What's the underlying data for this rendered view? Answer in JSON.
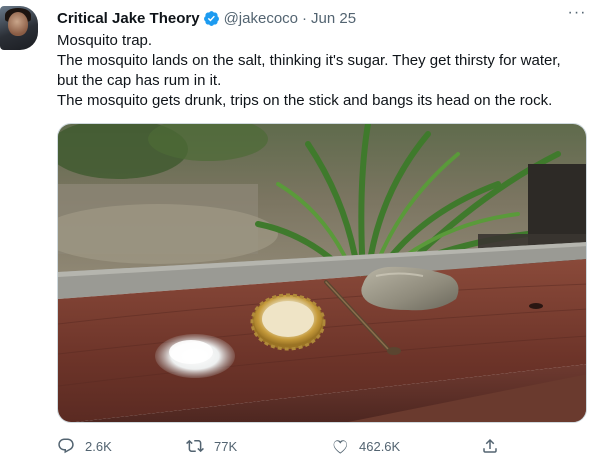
{
  "user": {
    "display_name": "Critical Jake Theory",
    "handle": "@jakecoco",
    "separator": "·",
    "date": "Jun 25"
  },
  "tweet": {
    "lines": [
      "Mosquito trap.",
      "The mosquito lands on the salt, thinking it's sugar. They get thirsty for water,",
      "but the cap has rum in it.",
      "The mosquito gets drunk, trips on the stick and bangs its head on the rock."
    ]
  },
  "more_label": "···",
  "actions": {
    "replies": "2.6K",
    "retweets": "77K",
    "likes": "462.6K"
  },
  "colors": {
    "text": "#0f1419",
    "secondary": "#536471",
    "verified": "#1d9bf0"
  },
  "icons": [
    "verified-badge-icon",
    "more-icon",
    "reply-icon",
    "retweet-icon",
    "like-icon",
    "share-icon"
  ]
}
